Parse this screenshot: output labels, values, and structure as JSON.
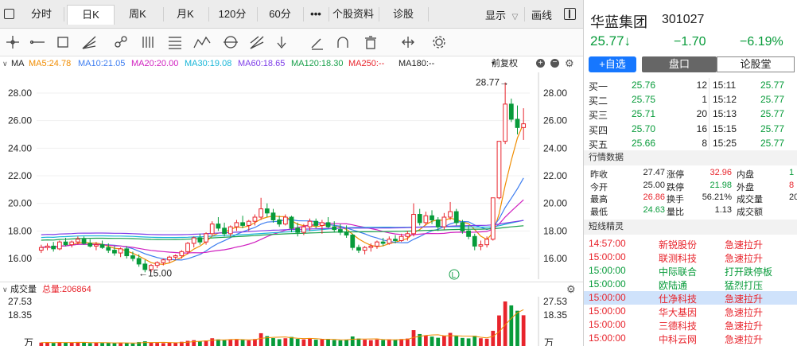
{
  "tabs": [
    {
      "label": "分时",
      "selected": false
    },
    {
      "label": "日K",
      "selected": true
    },
    {
      "label": "周K",
      "selected": false
    },
    {
      "label": "月K",
      "selected": false
    },
    {
      "label": "120分",
      "selected": false
    },
    {
      "label": "60分",
      "selected": false
    },
    {
      "label": "•••",
      "selected": false
    },
    {
      "label": "个股资料",
      "selected": false
    },
    {
      "label": "诊股",
      "selected": false
    }
  ],
  "display_label": "显示",
  "draw_label": "画线",
  "toolbar_icons": [
    "crosshair-icon",
    "horizontal-line-icon",
    "rect-select-icon",
    "fan-line-icon",
    "link-icon",
    "parallel-lines-icon",
    "fib-icon",
    "wave-icon",
    "cycle-icon",
    "gann-icon",
    "down-arrow-icon",
    "pencil-icon",
    "magnet-icon",
    "trash-icon",
    "range-icon",
    "settings-icon"
  ],
  "ma_legend": {
    "title": "MA",
    "items": [
      {
        "text": "MA5:24.78",
        "color": "#f08c00"
      },
      {
        "text": "MA10:21.05",
        "color": "#3d7df0"
      },
      {
        "text": "MA20:20.00",
        "color": "#d020c0"
      },
      {
        "text": "MA30:19.08",
        "color": "#18b6d8"
      },
      {
        "text": "MA60:18.65",
        "color": "#7d3ce8"
      },
      {
        "text": "MA120:18.30",
        "color": "#18a04a"
      },
      {
        "text": "MA250:--",
        "color": "#e8242c"
      },
      {
        "text": "MA180:--",
        "color": "#222222"
      }
    ],
    "adjust": "前复权"
  },
  "colors": {
    "up": "#e8242c",
    "down": "#079b3a",
    "accent": "#1677ff"
  },
  "chart_data": {
    "type": "candlestick",
    "title": "",
    "ylim": [
      14.5,
      29.5
    ],
    "y_ticks": [
      16.0,
      18.0,
      20.0,
      22.0,
      24.0,
      26.0,
      28.0
    ],
    "y_tick_labels": [
      "16.00",
      "18.00",
      "20.00",
      "22.00",
      "24.00",
      "26.00",
      "28.00"
    ],
    "annotations": [
      {
        "text": "28.77→",
        "value": 28.77
      },
      {
        "text": "←15.00",
        "value": 15.0
      }
    ],
    "ma_line_color_names": [
      "MA5",
      "MA10",
      "MA20",
      "MA30",
      "MA60",
      "MA120"
    ],
    "ohlc": [
      [
        16.6,
        17.0,
        16.4,
        16.8
      ],
      [
        16.8,
        17.1,
        16.6,
        16.9
      ],
      [
        16.9,
        17.2,
        16.5,
        16.7
      ],
      [
        16.7,
        17.3,
        16.6,
        17.2
      ],
      [
        17.2,
        17.5,
        16.9,
        17.0
      ],
      [
        17.0,
        17.3,
        16.8,
        17.2
      ],
      [
        17.2,
        17.6,
        17.0,
        17.4
      ],
      [
        17.4,
        17.6,
        17.0,
        17.1
      ],
      [
        17.1,
        17.4,
        16.8,
        16.9
      ],
      [
        16.9,
        17.2,
        16.6,
        17.0
      ],
      [
        17.0,
        17.3,
        16.7,
        16.8
      ],
      [
        16.8,
        17.1,
        16.4,
        16.6
      ],
      [
        16.6,
        16.9,
        16.2,
        16.4
      ],
      [
        16.4,
        16.8,
        16.1,
        16.7
      ],
      [
        16.7,
        16.9,
        16.0,
        16.2
      ],
      [
        16.2,
        16.5,
        15.8,
        16.0
      ],
      [
        16.0,
        16.3,
        15.4,
        15.6
      ],
      [
        15.6,
        15.9,
        15.0,
        15.2
      ],
      [
        15.2,
        15.6,
        15.0,
        15.5
      ],
      [
        15.5,
        15.8,
        15.3,
        15.7
      ],
      [
        15.7,
        16.0,
        15.5,
        15.9
      ],
      [
        15.9,
        16.2,
        15.7,
        16.1
      ],
      [
        16.1,
        16.3,
        15.9,
        16.2
      ],
      [
        16.2,
        16.6,
        16.0,
        16.5
      ],
      [
        16.5,
        17.2,
        16.3,
        17.1
      ],
      [
        17.1,
        17.6,
        16.8,
        17.5
      ],
      [
        17.5,
        17.8,
        17.0,
        17.2
      ],
      [
        17.2,
        17.9,
        17.0,
        17.8
      ],
      [
        17.8,
        18.7,
        17.6,
        18.5
      ],
      [
        18.5,
        19.0,
        18.0,
        18.2
      ],
      [
        18.2,
        18.6,
        17.6,
        17.8
      ],
      [
        17.8,
        18.4,
        17.6,
        18.3
      ],
      [
        18.3,
        18.8,
        18.0,
        18.6
      ],
      [
        18.6,
        19.1,
        18.2,
        18.4
      ],
      [
        18.4,
        18.8,
        18.0,
        18.7
      ],
      [
        18.7,
        19.2,
        18.4,
        19.0
      ],
      [
        19.0,
        20.4,
        18.8,
        19.6
      ],
      [
        19.6,
        20.0,
        19.0,
        19.3
      ],
      [
        19.3,
        19.6,
        18.6,
        18.8
      ],
      [
        18.8,
        19.1,
        18.3,
        18.5
      ],
      [
        18.5,
        19.2,
        18.4,
        19.0
      ],
      [
        19.0,
        19.1,
        17.9,
        18.2
      ],
      [
        18.2,
        18.6,
        17.6,
        17.9
      ],
      [
        17.9,
        18.5,
        17.7,
        18.3
      ],
      [
        18.3,
        18.9,
        18.0,
        18.7
      ],
      [
        18.7,
        18.9,
        18.2,
        18.4
      ],
      [
        18.4,
        18.8,
        17.8,
        18.6
      ],
      [
        18.6,
        19.0,
        18.2,
        18.3
      ],
      [
        18.3,
        18.7,
        17.9,
        18.1
      ],
      [
        18.1,
        18.5,
        17.7,
        17.9
      ],
      [
        17.9,
        18.4,
        17.5,
        17.7
      ],
      [
        17.7,
        17.8,
        16.6,
        16.8
      ],
      [
        16.8,
        17.0,
        16.4,
        16.6
      ],
      [
        16.6,
        16.9,
        16.3,
        16.8
      ],
      [
        16.8,
        17.1,
        16.5,
        16.9
      ],
      [
        16.9,
        17.3,
        16.7,
        17.2
      ],
      [
        17.2,
        17.5,
        16.9,
        17.1
      ],
      [
        17.1,
        17.6,
        17.0,
        17.4
      ],
      [
        17.4,
        17.7,
        17.1,
        17.3
      ],
      [
        17.3,
        17.8,
        17.2,
        17.6
      ],
      [
        17.6,
        18.0,
        17.3,
        17.8
      ],
      [
        17.8,
        20.0,
        17.6,
        19.2
      ],
      [
        19.2,
        19.6,
        18.4,
        18.6
      ],
      [
        18.6,
        19.4,
        18.4,
        19.1
      ],
      [
        19.1,
        19.5,
        18.5,
        18.8
      ],
      [
        18.8,
        19.0,
        18.0,
        18.3
      ],
      [
        18.3,
        19.3,
        18.1,
        19.0
      ],
      [
        19.0,
        20.1,
        18.8,
        19.4
      ],
      [
        19.4,
        19.6,
        18.4,
        18.6
      ],
      [
        18.6,
        18.8,
        17.8,
        18.0
      ],
      [
        18.0,
        18.4,
        17.4,
        17.6
      ],
      [
        17.6,
        17.8,
        16.6,
        16.9
      ],
      [
        16.9,
        17.3,
        16.6,
        17.0
      ],
      [
        17.0,
        17.6,
        16.8,
        17.4
      ],
      [
        17.4,
        20.4,
        17.3,
        20.4
      ],
      [
        20.4,
        24.5,
        20.3,
        24.5
      ],
      [
        24.5,
        28.77,
        24.3,
        27.2
      ],
      [
        27.2,
        27.6,
        25.9,
        26.1
      ],
      [
        26.1,
        27.1,
        25.0,
        25.5
      ],
      [
        25.5,
        26.9,
        24.6,
        25.77
      ]
    ],
    "volume": {
      "title": "成交量",
      "total_label": "总量:206864",
      "y_tick_labels": [
        "27.53",
        "18.35"
      ],
      "unit_label": "万",
      "values": [
        2.1,
        2.3,
        1.9,
        2.4,
        2.0,
        2.2,
        2.5,
        2.1,
        1.8,
        2.0,
        1.9,
        2.2,
        1.7,
        2.0,
        1.8,
        1.6,
        2.4,
        2.9,
        2.2,
        1.9,
        1.8,
        2.0,
        2.1,
        2.6,
        3.2,
        3.6,
        2.9,
        3.4,
        4.8,
        4.1,
        3.6,
        3.9,
        4.2,
        3.8,
        3.5,
        4.3,
        7.9,
        6.1,
        4.9,
        4.2,
        4.8,
        5.6,
        4.4,
        4.1,
        4.6,
        3.9,
        4.2,
        4.0,
        3.7,
        3.5,
        3.8,
        5.9,
        4.6,
        3.9,
        3.6,
        4.0,
        3.7,
        4.1,
        3.8,
        4.3,
        4.6,
        9.8,
        7.4,
        6.6,
        5.8,
        5.1,
        6.4,
        8.1,
        6.2,
        5.0,
        4.7,
        6.3,
        4.8,
        4.5,
        9.4,
        18.9,
        27.53,
        25.1,
        21.8,
        19.0
      ]
    }
  },
  "quote": {
    "name": "华蓝集团",
    "code": "301027",
    "price": "25.77",
    "arrow": "↓",
    "change": "−1.70",
    "change_pct": "−6.19%",
    "add_watch": "+自选",
    "tab_pankou": "盘口",
    "tab_lungu": "论股堂"
  },
  "bids": [
    {
      "label": "买一",
      "price": "25.76",
      "vol": "12",
      "time": "15:11",
      "tprice": "25.77"
    },
    {
      "label": "买二",
      "price": "25.75",
      "vol": "1",
      "time": "15:12",
      "tprice": "25.77"
    },
    {
      "label": "买三",
      "price": "25.71",
      "vol": "20",
      "time": "15:13",
      "tprice": "25.77"
    },
    {
      "label": "买四",
      "price": "25.70",
      "vol": "16",
      "time": "15:15",
      "tprice": "25.77"
    },
    {
      "label": "买五",
      "price": "25.66",
      "vol": "8",
      "time": "15:25",
      "tprice": "25.77"
    }
  ],
  "market_title": "行情数据",
  "market_rows": [
    {
      "l1": "昨收",
      "v1": "27.47",
      "l2": "涨停",
      "v2": "32.96",
      "l3": "内盘",
      "v3": "1"
    },
    {
      "l1": "今开",
      "v1": "25.00",
      "l2": "跌停",
      "v2": "21.98",
      "l3": "外盘",
      "v3": "8"
    },
    {
      "l1": "最高",
      "v1": "26.86",
      "l2": "换手",
      "v2": "56.21%",
      "l3": "成交量",
      "v3": "20"
    },
    {
      "l1": "最低",
      "v1": "24.63",
      "l2": "量比",
      "v2": "1.13",
      "l3": "成交额",
      "v3": ""
    }
  ],
  "spirit_title": "短线精灵",
  "spirit_rows": [
    {
      "time": "14:57:00",
      "stock": "新锐股份",
      "action": "急速拉升",
      "color": "red",
      "hl": false
    },
    {
      "time": "15:00:00",
      "stock": "联测科技",
      "action": "急速拉升",
      "color": "red",
      "hl": false
    },
    {
      "time": "15:00:00",
      "stock": "中际联合",
      "action": "打开跌停板",
      "color": "green",
      "hl": false
    },
    {
      "time": "15:00:00",
      "stock": "欧陆通",
      "action": "猛烈打压",
      "color": "green",
      "hl": false
    },
    {
      "time": "15:00:00",
      "stock": "仕净科技",
      "action": "急速拉升",
      "color": "red",
      "hl": true
    },
    {
      "time": "15:00:00",
      "stock": "华大基因",
      "action": "急速拉升",
      "color": "red",
      "hl": false
    },
    {
      "time": "15:00:00",
      "stock": "三德科技",
      "action": "急速拉升",
      "color": "red",
      "hl": false
    },
    {
      "time": "15:00:00",
      "stock": "中科云网",
      "action": "急速拉升",
      "color": "red",
      "hl": false
    }
  ]
}
